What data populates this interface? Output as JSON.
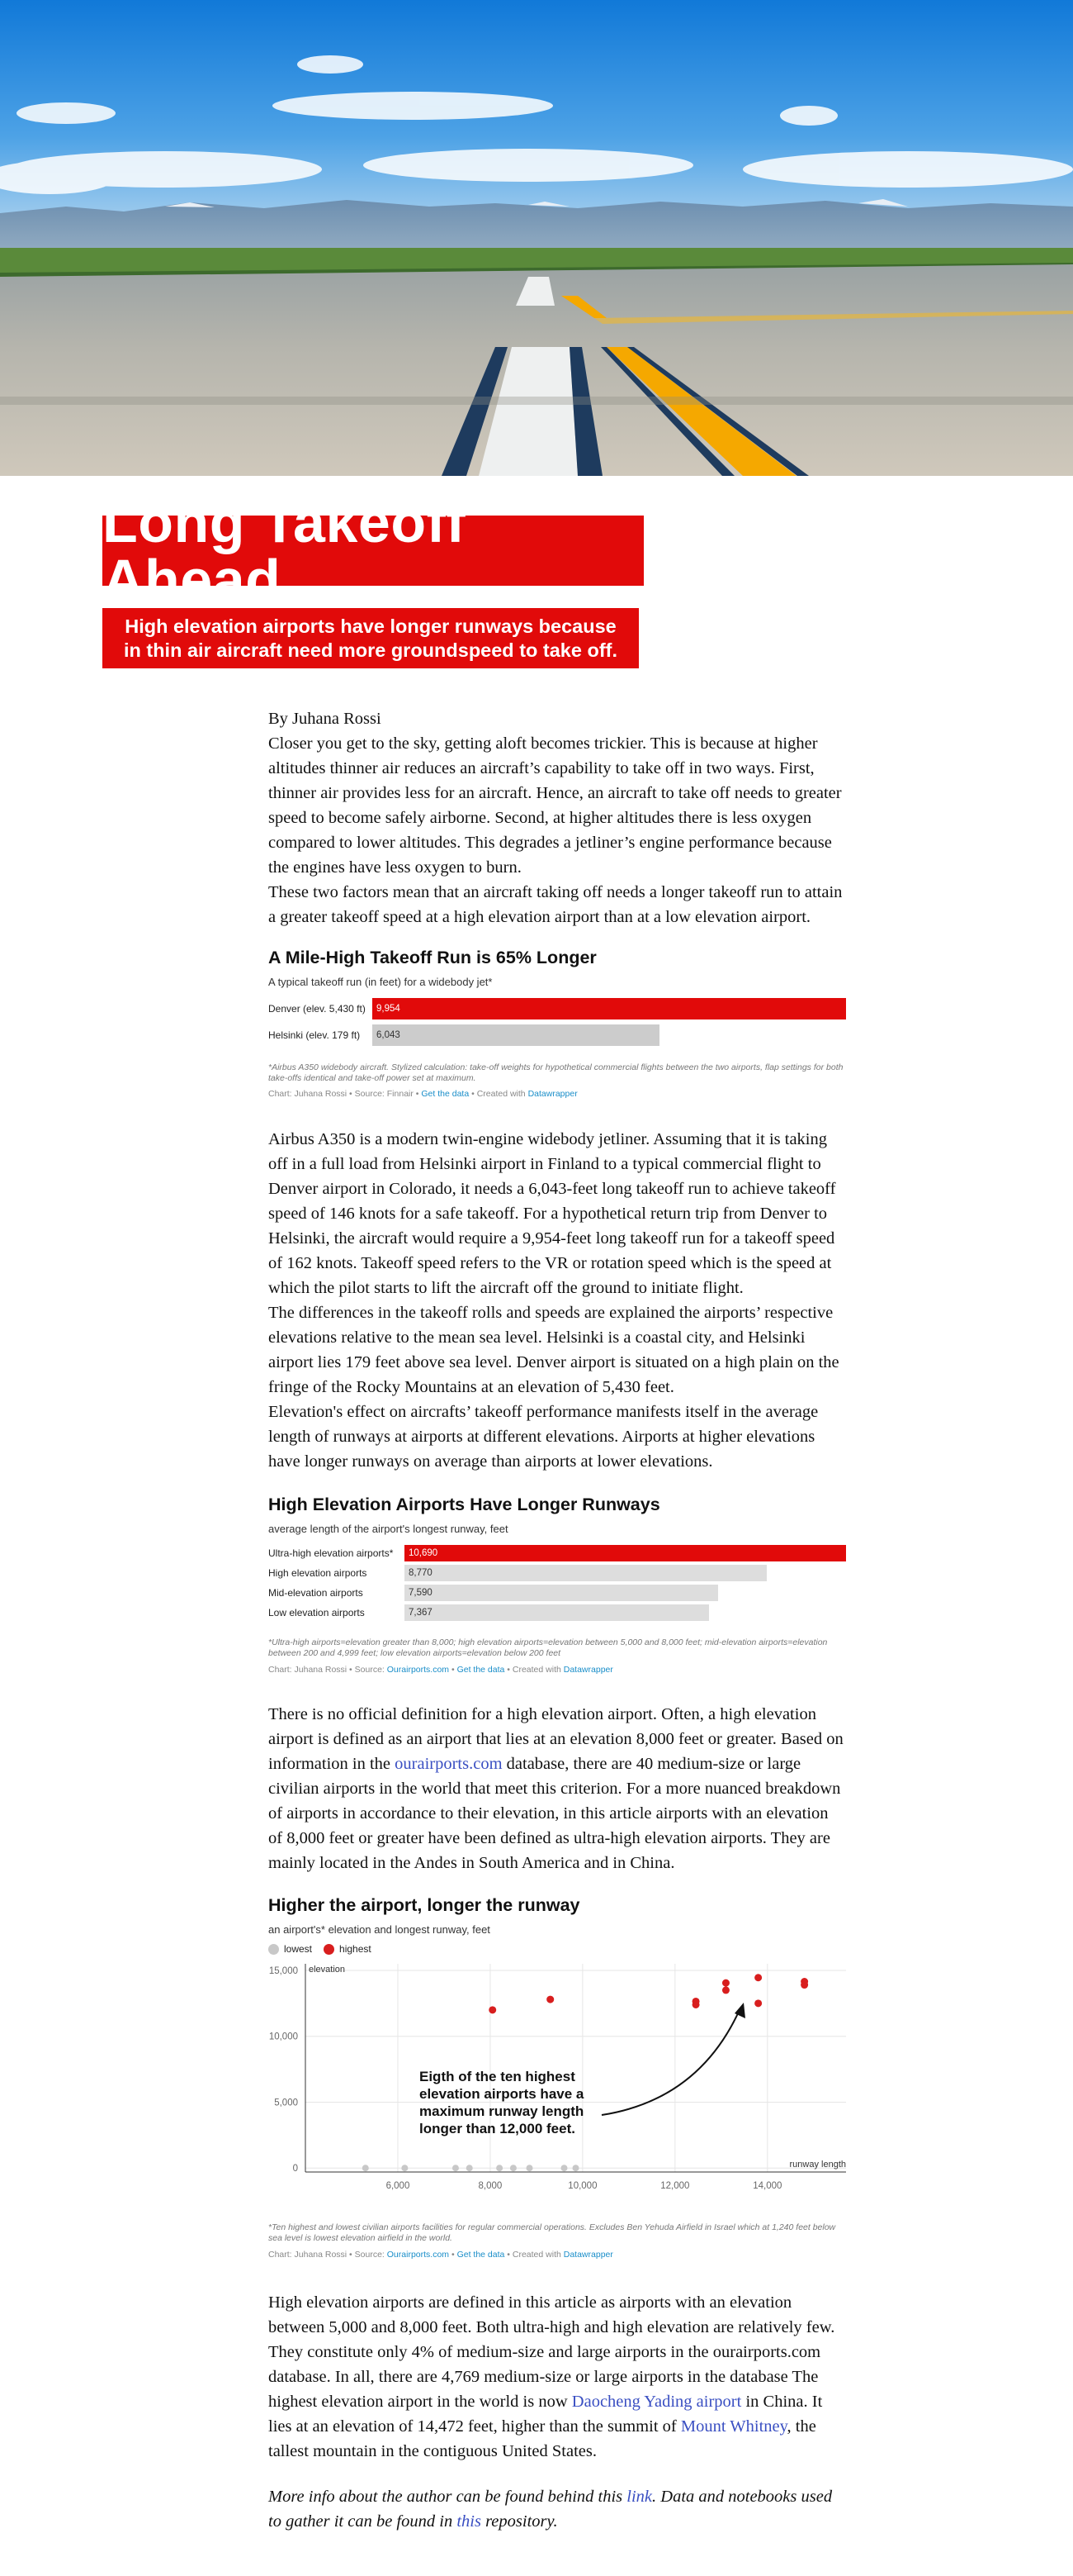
{
  "article": {
    "title": "Long Takeoff Ahead",
    "subtitle": "High elevation airports have longer runways because\nin thin air aircraft need more groundspeed to take off.",
    "byline": "By Juhana Rossi",
    "intro_p1": "Closer you get to the sky, getting aloft becomes trickier. This is because at higher altitudes thinner air reduces an aircraft’s capability to take off in two ways. First, thinner air provides less for an aircraft. Hence, an aircraft to take off needs to greater speed to become safely airborne. Second, at higher altitudes there is less oxygen compared to lower altitudes. This degrades a jetliner’s engine performance because the engines have less oxygen to burn.",
    "intro_p2": "These two factors mean that an aircraft taking off needs a longer takeoff run to attain a greater takeoff speed at a high elevation airport than at a low elevation airport.",
    "mid_p1": "Airbus A350 is a modern twin-engine widebody jetliner. Assuming that it is taking off in a full load from Helsinki airport in Finland to a typical commercial flight to Denver airport in Colorado, it needs a 6,043-feet long takeoff run to achieve takeoff speed of 146 knots for a safe takeoff. For a hypothetical return trip from Denver to Helsinki, the aircraft would require a 9,954-feet long takeoff run for a takeoff speed of 162 knots. Takeoff speed refers to the VR or rotation speed which is the speed at which the pilot starts to lift the aircraft off the ground to initiate flight.",
    "mid_p2": "The differences in the takeoff rolls and speeds are explained the airports’ respective elevations relative to the mean sea level. Helsinki is a coastal city, and Helsinki airport lies 179 feet above sea level. Denver airport is situated on a high plain on the fringe of the Rocky Mountains at an elevation of 5,430 feet.",
    "mid_p3": "Elevation's effect on aircrafts’ takeoff performance manifests itself in the average length of runways at airports at different elevations. Airports at higher elevations have longer runways on average than airports at lower elevations.",
    "def_before": "There is no official definition for a high elevation airport. Often, a high elevation airport is defined as an airport that lies at an elevation 8,000 feet or greater. Based on information in the ",
    "def_link": "ourairports.com",
    "def_after": " database, there are 40 medium-size or large civilian airports in the world that meet this criterion. For a more nuanced breakdown of airports in accordance to their elevation, in this article airports with an elevation of 8,000 feet or greater have been defined as ultra-high elevation airports. They are mainly located in the Andes in South America and in China.",
    "end_before": "High elevation airports are defined in this article as airports with an elevation between 5,000 and 8,000 feet. Both ultra-high and high elevation are relatively few. They constitute only 4% of medium-size and large airports in the ourairports.com database. In all, there are 4,769 medium-size or large airports in the database The highest elevation airport in the world is now ",
    "end_link1": "Daocheng Yading airport",
    "end_mid": " in China. It lies at an elevation of 14,472 feet, higher than the summit of ",
    "end_link2": "Mount Whitney",
    "end_after": ", the tallest mountain in the contiguous United States.",
    "foot_before": "More info about the author can be found behind this ",
    "foot_link1": "link",
    "foot_mid": ". Data and notebooks used to gather it can be found in ",
    "foot_link2": "this",
    "foot_after": " repository."
  },
  "credits": {
    "chart_by": "Chart: Juhana Rossi",
    "sep": " • ",
    "source_label": "Source: ",
    "get_data": "Get the data",
    "created_with": "Created with ",
    "datawrapper": "Datawrapper"
  },
  "chart1_text": {
    "title": "A Mile-High Takeoff Run is 65% Longer",
    "description": "A typical takeoff run (in feet) for a widebody jet*",
    "note": "*Airbus A350 widebody aircraft. Stylized calculation: take-off weights for hypothetical commercial flights between the two airports, flap settings for both take-offs identical and take-off power set at maximum.",
    "source": "Finnair"
  },
  "chart2_text": {
    "title": "High Elevation Airports Have Longer Runways",
    "description": "average length of the airport's longest runway, feet",
    "note": "*Ultra-high airports=elevation greater than 8,000; high elevation airports=elevation between 5,000 and 8,000 feet; mid-elevation airports=elevation between 200 and 4,999 feet; low elevation airports=elevation below 200 feet",
    "source": "Ourairports.com"
  },
  "chart3_text": {
    "title": "Higher the airport, longer the runway",
    "description": "an airport's* elevation and longest runway, feet",
    "legend_lowest": "lowest",
    "legend_highest": "highest",
    "annotation": "Eigth of the ten highest elevation airports have a maximum runway length longer than 12,000 feet.",
    "note": "*Ten highest and lowest civilian airports facilities for regular commercial operations. Excludes Ben Yehuda Airfield in Israel which at 1,240 feet below sea level is lowest elevation airfield in the world.",
    "source": "Ourairports.com"
  },
  "chart_data": [
    {
      "type": "bar",
      "title": "A Mile-High Takeoff Run is 65% Longer",
      "categories": [
        "Denver (elev. 5,430 ft)",
        "Helsinki (elev. 179 ft)"
      ],
      "values": [
        9954,
        6043
      ],
      "labels": [
        "9,954",
        "6,043"
      ],
      "colors": [
        "#e10a0a",
        "#cccccc"
      ],
      "xlim": [
        0,
        9954
      ]
    },
    {
      "type": "bar",
      "title": "High Elevation Airports Have Longer Runways",
      "categories": [
        "Ultra-high elevation airports*",
        "High elevation airports",
        "Mid-elevation airports",
        "Low elevation airports"
      ],
      "values": [
        10690,
        8770,
        7590,
        7367
      ],
      "labels": [
        "10,690",
        "8,770",
        "7,590",
        "7,367"
      ],
      "colors": [
        "#e10a0a",
        "#dddddd",
        "#dddddd",
        "#dddddd"
      ],
      "xlim": [
        0,
        10690
      ]
    },
    {
      "type": "scatter",
      "title": "Higher the airport, longer the runway",
      "xlabel": "runway length",
      "ylabel": "elevation",
      "xlim": [
        4000,
        15700
      ],
      "ylim": [
        -300,
        15500
      ],
      "xticks": [
        6000,
        8000,
        10000,
        12000,
        14000
      ],
      "xticklabels": [
        "6,000",
        "8,000",
        "10,000",
        "12,000",
        "14,000"
      ],
      "yticks": [
        0,
        5000,
        10000,
        15000
      ],
      "yticklabels": [
        "0",
        "5,000",
        "10,000",
        "15,000"
      ],
      "grid": true,
      "series": [
        {
          "name": "lowest",
          "color": "#c8c8c8",
          "points": [
            [
              5300,
              0
            ],
            [
              6150,
              0
            ],
            [
              7250,
              0
            ],
            [
              7550,
              0
            ],
            [
              8200,
              0
            ],
            [
              8500,
              0
            ],
            [
              8850,
              0
            ],
            [
              9600,
              0
            ],
            [
              9850,
              0
            ]
          ]
        },
        {
          "name": "highest",
          "color": "#d81e1e",
          "points": [
            [
              8050,
              12000
            ],
            [
              9300,
              12800
            ],
            [
              12450,
              12400
            ],
            [
              12450,
              12650
            ],
            [
              13100,
              13500
            ],
            [
              13100,
              14050
            ],
            [
              13800,
              14450
            ],
            [
              13800,
              12500
            ],
            [
              14800,
              14150
            ],
            [
              14800,
              13900
            ]
          ]
        }
      ]
    }
  ]
}
